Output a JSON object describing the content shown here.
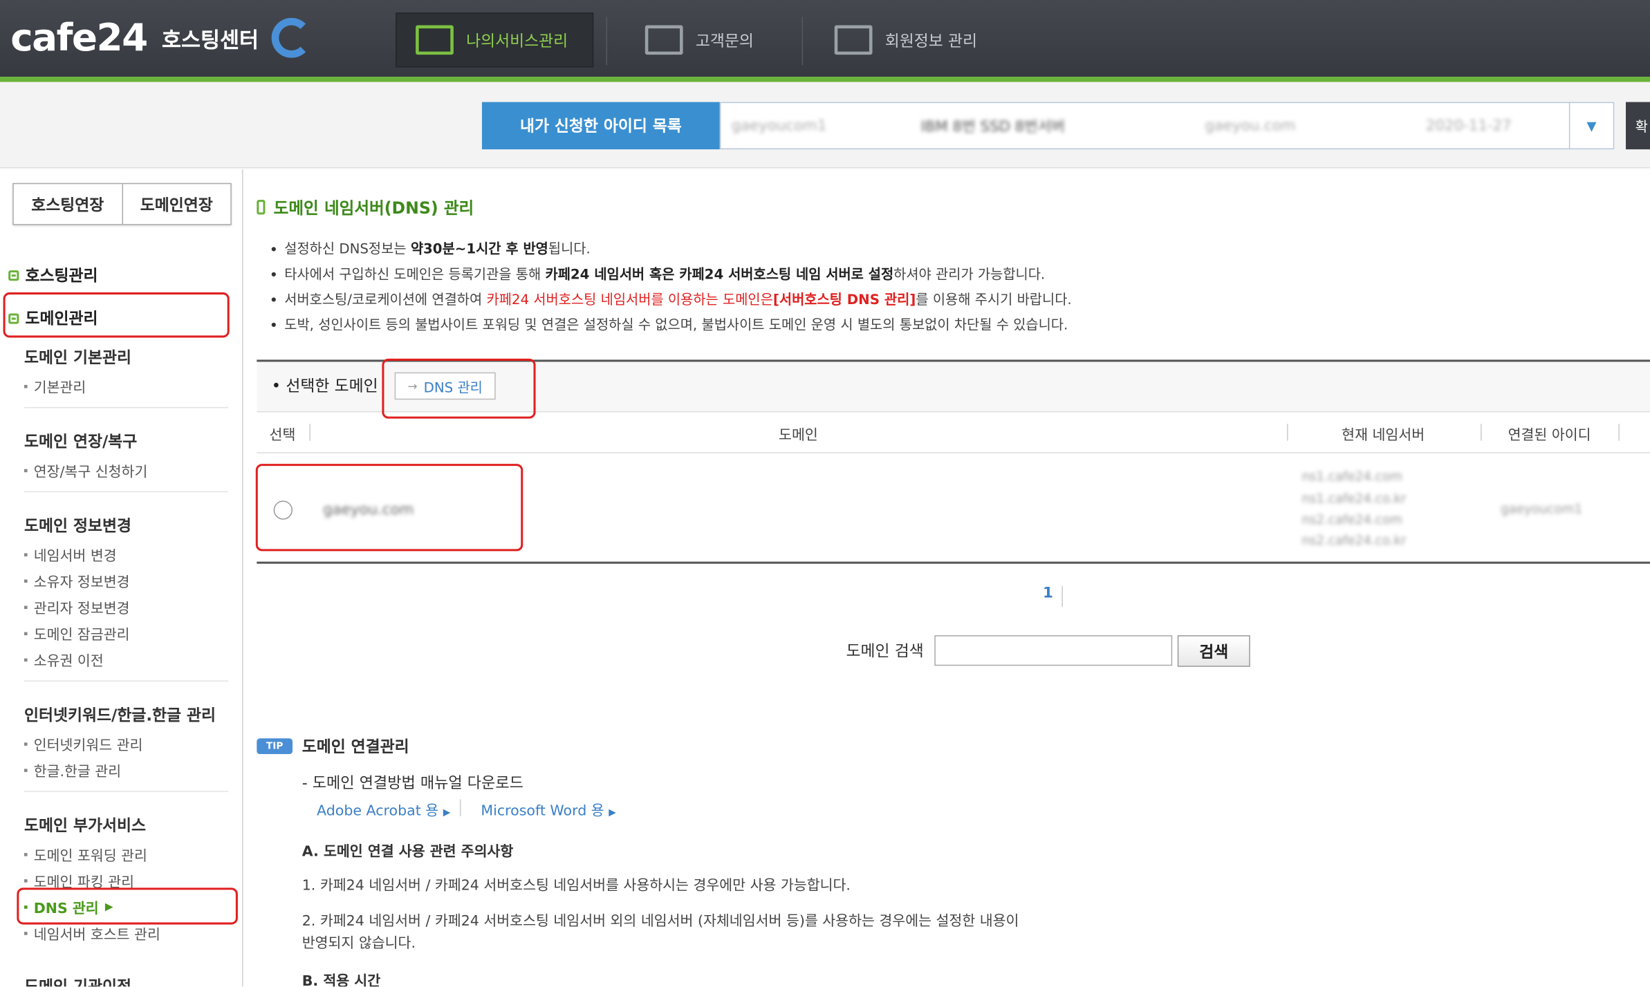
{
  "header": {
    "logo_text": "cafe24",
    "logo_sub": "호스팅센터",
    "nav": [
      {
        "label": "나의서비스관리",
        "icon": "service-gear-icon",
        "active": true
      },
      {
        "label": "고객문의",
        "icon": "customer-inquiry-icon",
        "active": false
      },
      {
        "label": "회원정보 관리",
        "icon": "member-info-icon",
        "active": false
      }
    ]
  },
  "idbar": {
    "label": "내가 신청한 아이디 목록",
    "cells": [
      "gaeyoucom1",
      "IBM 8번 SSD 8번서버",
      "gaeyou.com",
      "2020-11-27"
    ],
    "button_text": "확"
  },
  "sidebar": {
    "ext_tabs": [
      "호스팅연장",
      "도메인연장"
    ],
    "sections": {
      "hosting": "호스팅관리",
      "domain": "도메인관리"
    },
    "groups": [
      {
        "title": "도메인 기본관리",
        "items": [
          "기본관리"
        ]
      },
      {
        "title": "도메인 연장/복구",
        "items": [
          "연장/복구 신청하기"
        ]
      },
      {
        "title": "도메인 정보변경",
        "items": [
          "네임서버 변경",
          "소유자 정보변경",
          "관리자 정보변경",
          "도메인 잠금관리",
          "소유권 이전"
        ]
      },
      {
        "title": "인터넷키워드/한글.한글 관리",
        "items": [
          "인터넷키워드 관리",
          "한글.한글 관리"
        ]
      },
      {
        "title": "도메인 부가서비스",
        "items": [
          "도메인 포워딩 관리",
          "도메인 파킹 관리",
          "DNS 관리",
          "네임서버 호스트 관리"
        ]
      },
      {
        "title": "도메인 기관이전",
        "items": []
      }
    ],
    "active_item": "DNS 관리"
  },
  "main": {
    "title": "도메인 네임서버(DNS) 관리",
    "notes": [
      {
        "pre": "설정하신 DNS정보는 ",
        "bold": "약30분~1시간 후 반영",
        "post": "됩니다."
      },
      {
        "pre": "타사에서 구입하신 도메인은 등록기관을 통해 ",
        "bold": "카페24 네임서버 혹은 카페24 서버호스팅 네임 서버로 설정",
        "post": "하셔야 관리가 가능합니다."
      },
      {
        "pre": "서버호스팅/코로케이션에 연결하여 ",
        "red": "카페24 서버호스팅 네임서버를 이용하는 도메인은",
        "red_bold": "[서버호스팅 DNS 관리]",
        "post": "를 이용해 주시기 바랍니다."
      },
      {
        "pre": "도박, 성인사이트 등의 불법사이트 포워딩 및 연결은 설정하실 수 없으며, 불법사이트 도메인 운영 시 별도의 통보없이 차단될 수 있습니다."
      }
    ],
    "selected_label": "선택한 도메인",
    "dns_button": "DNS 관리",
    "table": {
      "headers": [
        "선택",
        "도메인",
        "현재 네임서버",
        "연결된 아이디"
      ],
      "rows": [
        {
          "domain": "gaeyou.com",
          "nameservers": [
            "ns1.cafe24.com",
            "ns1.cafe24.co.kr",
            "ns2.cafe24.com",
            "ns2.cafe24.co.kr"
          ],
          "user_id": "gaeyoucom1"
        }
      ]
    },
    "pagination": {
      "current": "1"
    },
    "search": {
      "label": "도메인 검색",
      "value": "",
      "button": "검색"
    },
    "tip": {
      "badge": "TIP",
      "title": "도메인 연결관리",
      "download_line": "- 도메인 연결방법 매뉴얼 다운로드",
      "links": [
        "Adobe Acrobat 용",
        "Microsoft Word 용"
      ],
      "sectionA": "A. 도메인 연결 사용 관련 주의사항",
      "line1": "1. 카페24 네임서버 / 카페24 서버호스팅 네임서버를 사용하시는 경우에만 사용 가능합니다.",
      "line2a": "2. 카페24 네임서버 / 카페24 서버호스팅 네임서버 외의 네임서버 (자체네임서버 등)를 사용하는 경우에는 설정한 내용이",
      "line2b": "반영되지 않습니다.",
      "sectionB": "B. 적용 시간"
    }
  }
}
